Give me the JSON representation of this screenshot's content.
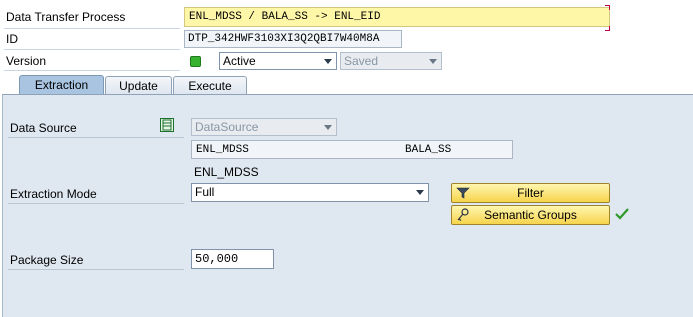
{
  "header": {
    "dtp_label": "Data Transfer Process",
    "dtp_value": "ENL_MDSS / BALA_SS -> ENL_EID",
    "id_label": "ID",
    "id_value": "DTP_342HWF3103XI3Q2QBI7W40M8A",
    "version_label": "Version",
    "version_value": "Active",
    "version_status": "Saved",
    "status_color": "#36b22e"
  },
  "tabs": [
    {
      "label": "Extraction",
      "active": true
    },
    {
      "label": "Update",
      "active": false
    },
    {
      "label": "Execute",
      "active": false
    }
  ],
  "extraction": {
    "data_source_label": "Data Source",
    "data_source_type": "DataSource",
    "data_source_icon": "datasource-icon",
    "source_name": "ENL_MDSS",
    "source_system": "BALA_SS",
    "source_description": "ENL_MDSS",
    "extraction_mode_label": "Extraction Mode",
    "extraction_mode_value": "Full",
    "filter_button": "Filter",
    "filter_icon": "funnel-icon",
    "semantic_groups_button": "Semantic Groups",
    "semantic_groups_icon": "key-icon",
    "semantic_groups_status_icon": "checkmark-icon",
    "package_size_label": "Package Size",
    "package_size_value": "50,000"
  },
  "colors": {
    "dtp_highlight": "#fff7a8",
    "button_bg": "#f6d44c",
    "panel_bg": "#dfe7f0",
    "active_tab": "#a8c4e0"
  }
}
